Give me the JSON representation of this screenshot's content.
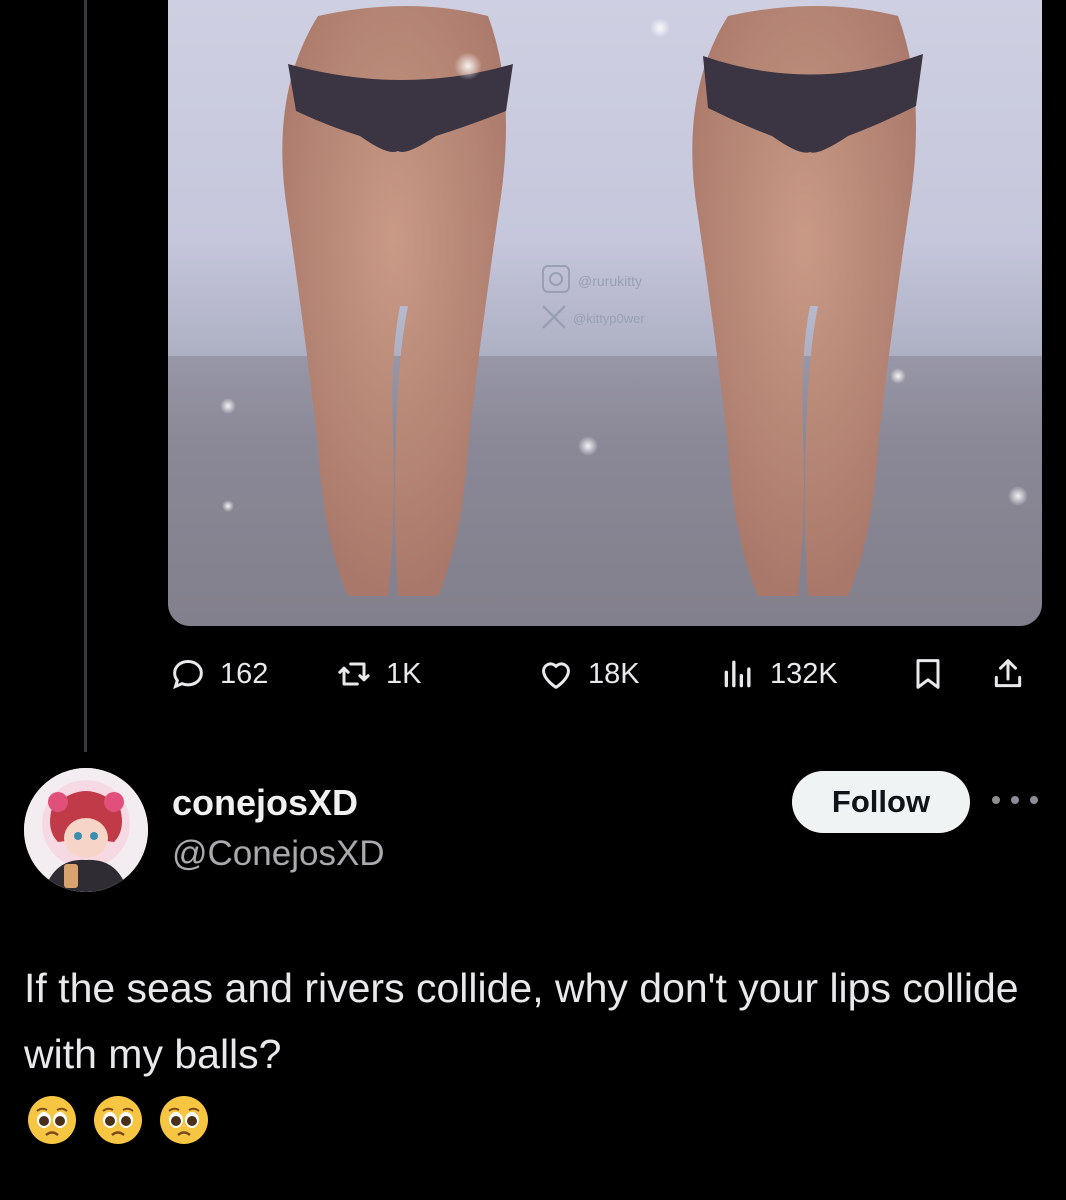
{
  "tweet": {
    "stats": {
      "replies": "162",
      "retweets": "1K",
      "likes": "18K",
      "views": "132K"
    }
  },
  "reply": {
    "author_name": "conejosXD",
    "author_handle": "@ConejosXD",
    "follow_label": "Follow",
    "text": "If the seas and rivers collide, why don't your lips collide with my balls?",
    "emojis": [
      "pleading-face",
      "pleading-face",
      "pleading-face"
    ]
  },
  "colors": {
    "background": "#000000",
    "text": "#e7e9ea",
    "muted": "#a9aaad",
    "follow_bg": "#eff3f4"
  }
}
